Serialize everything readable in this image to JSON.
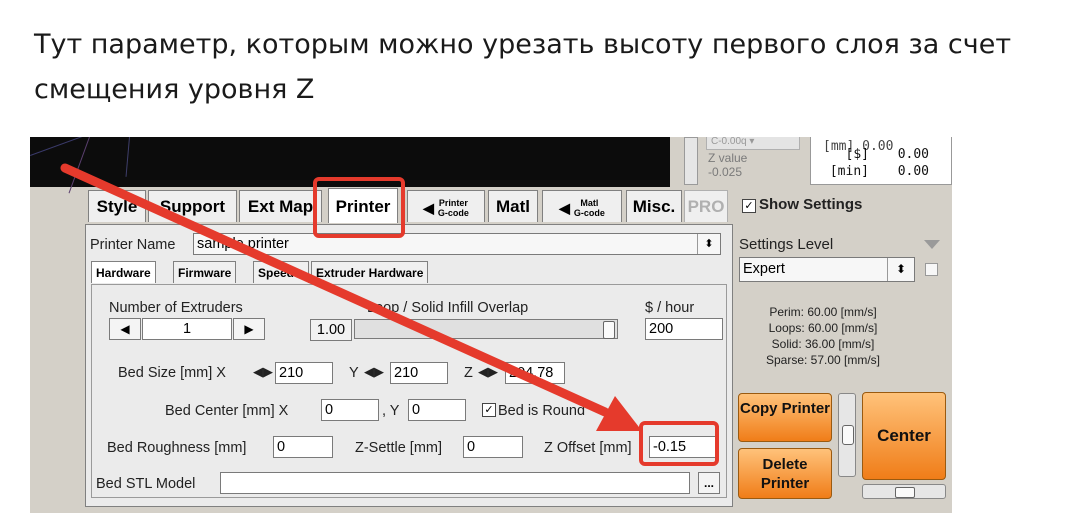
{
  "caption": {
    "line1": "Тут параметр, которым можно урезать высоту первого слоя за счет",
    "line2": "смещения уровня Z"
  },
  "top": {
    "z_value_label": "Z value",
    "z_value": "-0.025",
    "ghost_combo": "C-0.00q ▾",
    "stats": [
      {
        "label": "[$]",
        "value": "0.00"
      },
      {
        "label": "[min]",
        "value": "0.00"
      }
    ]
  },
  "tabs": [
    {
      "label": "Style"
    },
    {
      "label": "Support"
    },
    {
      "label": "Ext Map"
    },
    {
      "label": "Printer",
      "selected": true
    },
    {
      "label": "Printer G-code",
      "sub1": "Printer",
      "sub2": "G-code"
    },
    {
      "label": "Matl"
    },
    {
      "label": "Matl G-code",
      "sub1": "Matl",
      "sub2": "G-code"
    },
    {
      "label": "Misc."
    },
    {
      "label": "PRO"
    }
  ],
  "printer_name": {
    "label": "Printer Name",
    "value": "sample printer"
  },
  "subtabs": [
    {
      "label": "Hardware",
      "selected": true
    },
    {
      "label": "Firmware"
    },
    {
      "label": "Speed"
    },
    {
      "label": "Extruder Hardware"
    }
  ],
  "hardware": {
    "num_extruders_label": "Number of Extruders",
    "num_extruders_value": "1",
    "overlap_label": "Loop / Solid Infill Overlap",
    "overlap_value": "1.00",
    "cost_label": "$ / hour",
    "cost_value": "200",
    "bed_size_label": "Bed Size [mm]  X",
    "bed_x": "210",
    "bed_y_label": "Y",
    "bed_y": "210",
    "bed_z_label": "Z",
    "bed_z": "204.78",
    "bed_center_label": "Bed Center [mm]  X",
    "bed_center_x": "0",
    "bed_center_y_label": ", Y",
    "bed_center_y": "0",
    "bed_round_label": "Bed is Round",
    "bed_roughness_label": "Bed Roughness [mm]",
    "bed_roughness": "0",
    "z_settle_label": "Z-Settle [mm]",
    "z_settle": "0",
    "z_offset_label": "Z Offset [mm]",
    "z_offset": "-0.15",
    "bed_stl_label": "Bed STL Model",
    "bed_stl_value": "",
    "browse_label": "..."
  },
  "settings": {
    "show_settings_label": "Show Settings",
    "show_settings_checked": true,
    "level_label": "Settings Level",
    "level_value": "Expert",
    "speeds": [
      "Perim:  60.00 [mm/s]",
      "Loops:  60.00 [mm/s]",
      "Solid:  36.00 [mm/s]",
      "Sparse: 57.00 [mm/s]"
    ]
  },
  "buttons": {
    "copy_printer": "Copy Printer",
    "delete_printer": "Delete Printer",
    "center": "Center"
  },
  "colors": {
    "highlight": "#e53a2c",
    "orange": "#f07d18",
    "panel": "#d4d0c8"
  }
}
